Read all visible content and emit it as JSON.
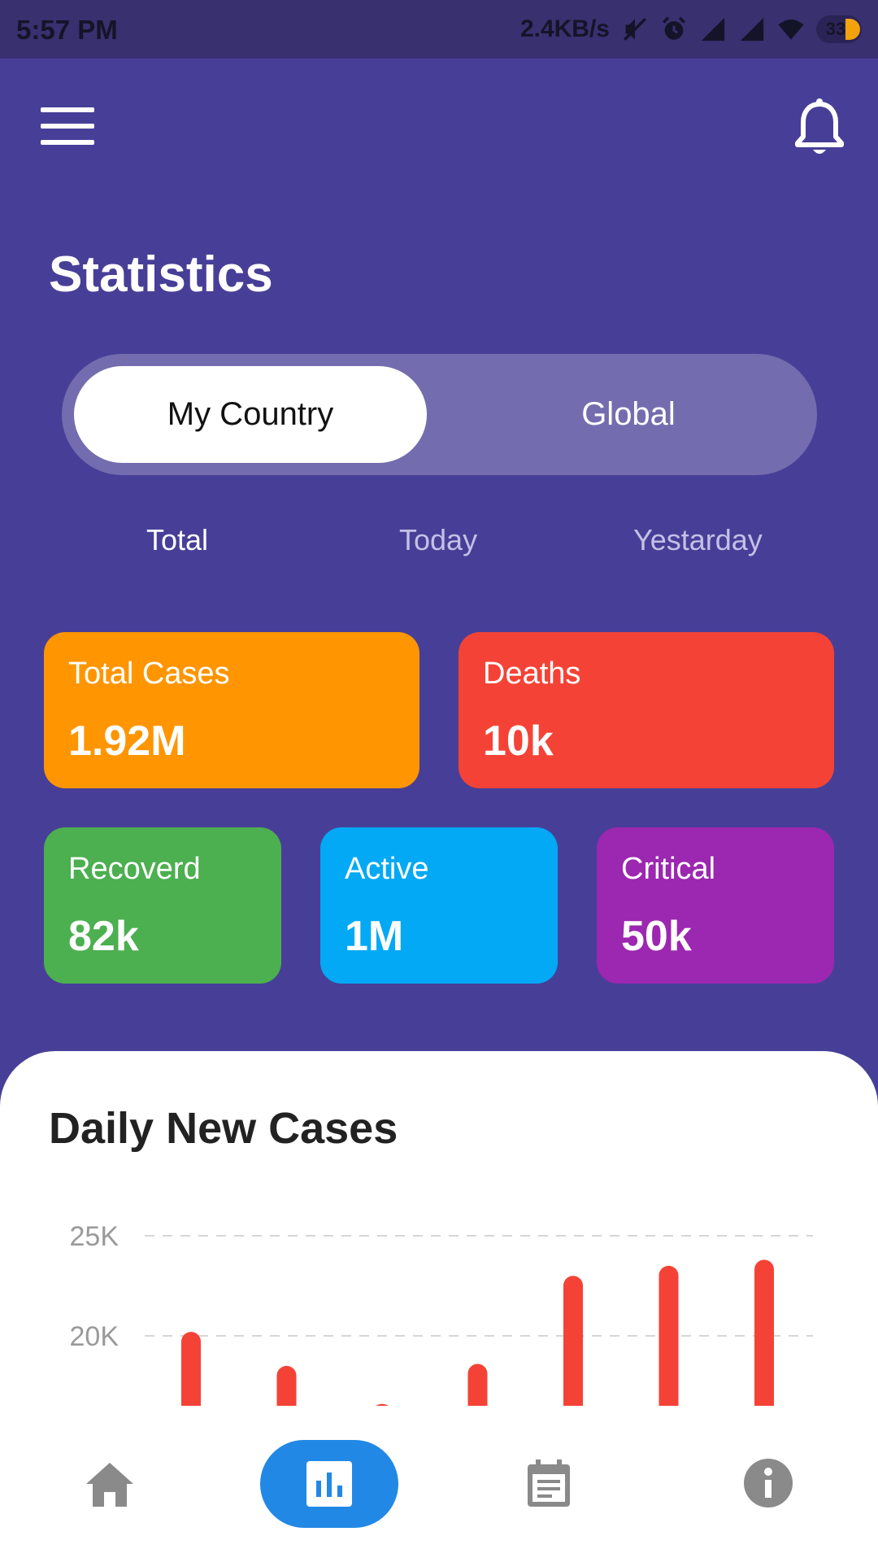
{
  "status_bar": {
    "time": "5:57 PM",
    "network_speed": "2.4KB/s",
    "battery": "33",
    "icons": [
      "mute-icon",
      "alarm-icon",
      "signal-icon",
      "signal-icon",
      "wifi-icon",
      "battery-icon"
    ]
  },
  "header": {
    "menu_icon": "hamburger-menu-icon",
    "notification_icon": "bell-icon"
  },
  "page_title": "Statistics",
  "scope_toggle": {
    "options": [
      "My Country",
      "Global"
    ],
    "selected": "My Country"
  },
  "period_tabs": {
    "items": [
      "Total",
      "Today",
      "Yestarday"
    ],
    "selected": "Total"
  },
  "stats": {
    "total_cases": {
      "label": "Total Cases",
      "value": "1.92M",
      "color": "#ff9500"
    },
    "deaths": {
      "label": "Deaths",
      "value": "10k",
      "color": "#f44336"
    },
    "recovered": {
      "label": "Recoverd",
      "value": "82k",
      "color": "#4caf50"
    },
    "active": {
      "label": "Active",
      "value": "1M",
      "color": "#03a9f4"
    },
    "critical": {
      "label": "Critical",
      "value": "50k",
      "color": "#9c27b0"
    }
  },
  "daily_chart": {
    "title": "Daily New Cases"
  },
  "chart_data": {
    "type": "bar",
    "title": "Daily New Cases",
    "ytick_labels": [
      "25K",
      "20K"
    ],
    "yticks": [
      25000,
      20000
    ],
    "values": [
      20200,
      18500,
      16600,
      18600,
      23000,
      23500,
      23800
    ],
    "bar_color": "#f44336",
    "grid": "dashed horizontal"
  },
  "bottom_nav": {
    "items": [
      {
        "icon": "home-icon",
        "active": false
      },
      {
        "icon": "bar-chart-icon",
        "active": true
      },
      {
        "icon": "calendar-icon",
        "active": false
      },
      {
        "icon": "info-icon",
        "active": false
      }
    ],
    "active_color": "#2288e6"
  }
}
